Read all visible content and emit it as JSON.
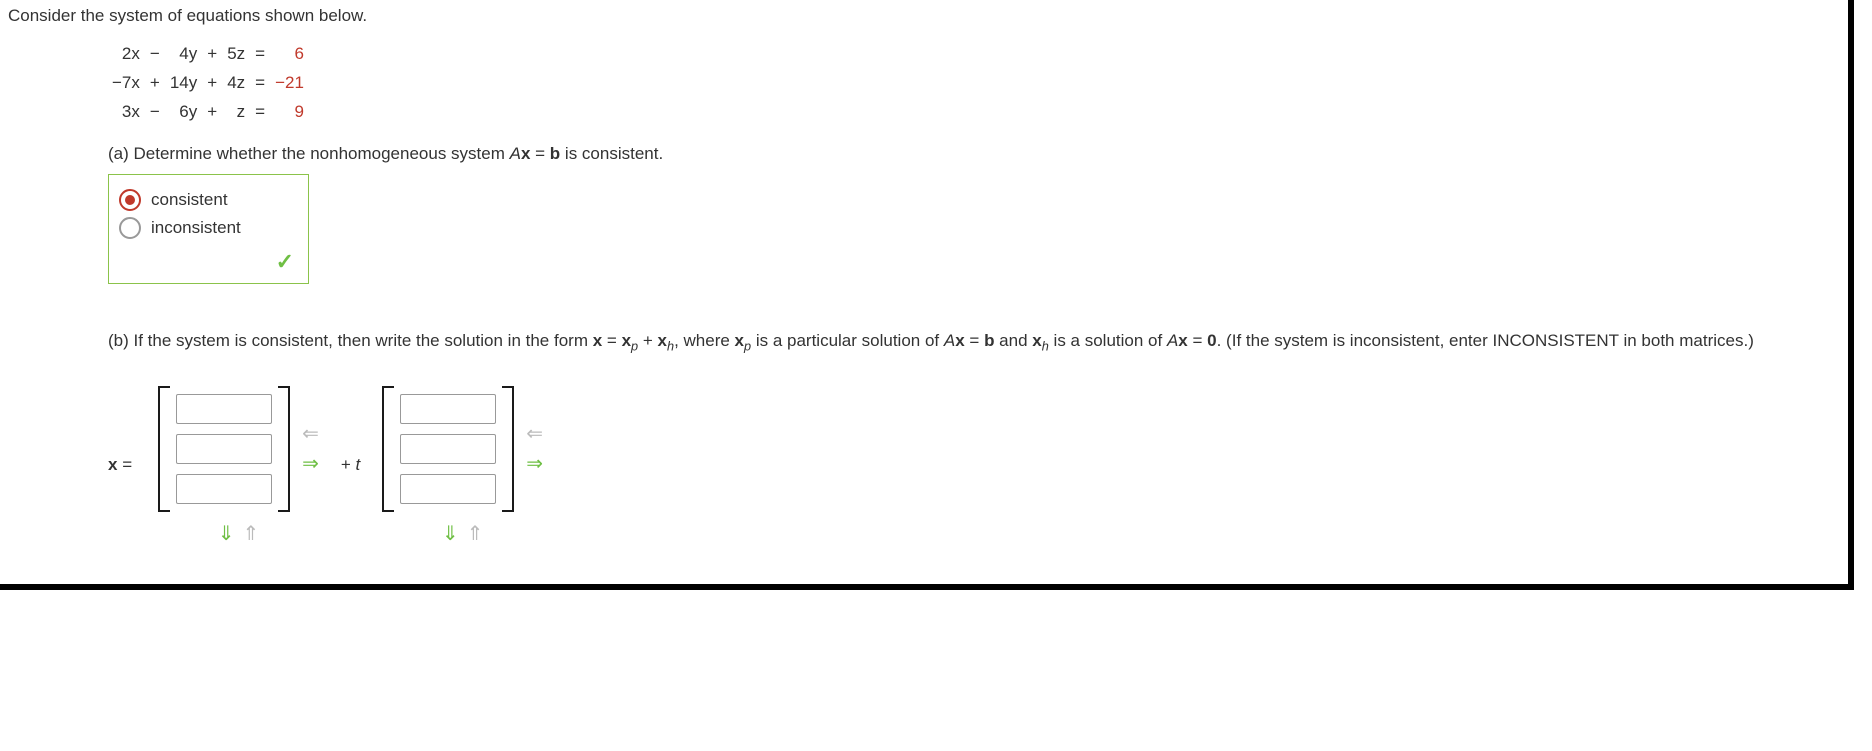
{
  "intro": "Consider the system of equations shown below.",
  "eq": {
    "r1": {
      "x": "2x",
      "s1": "−",
      "y": "4y",
      "s2": "+",
      "z": "5z",
      "eq": "=",
      "rhs": "6"
    },
    "r2": {
      "x": "−7x",
      "s1": "+",
      "y": "14y",
      "s2": "+",
      "z": "4z",
      "eq": "=",
      "rhs": "−21"
    },
    "r3": {
      "x": "3x",
      "s1": "−",
      "y": "6y",
      "s2": "+",
      "z": "z",
      "eq": "=",
      "rhs": "9"
    }
  },
  "partA": {
    "prefix": "(a) Determine whether the nonhomogeneous system ",
    "eqtext_A": "A",
    "eqtext_x": "x",
    "eqtext_eq": " = ",
    "eqtext_b": "b",
    "suffix": " is consistent.",
    "opt1": "consistent",
    "opt2": "inconsistent",
    "selected": "opt1"
  },
  "partB": {
    "t1": "(b) If the system is consistent, then write the solution in the form ",
    "t_x": "x",
    "t2": " = ",
    "t_xp_x": "x",
    "t_xp_p": "p",
    "t3": " + ",
    "t_xh_x": "x",
    "t_xh_h": "h",
    "t4": ", where ",
    "t_xp2_x": "x",
    "t_xp2_p": "p",
    "t5": " is a particular solution of ",
    "t_A": "A",
    "t_xx": "x",
    "t_eq": " = ",
    "t_b": "b",
    "t6": " and ",
    "t_xh2_x": "x",
    "t_xh2_h": "h",
    "t7": " is a solution of ",
    "t_A2": "A",
    "t_xx2": "x",
    "t_eq2": " = ",
    "t_zero": "0",
    "t8": ". (If the system is inconsistent, enter INCONSISTENT in both matrices.)",
    "label_x": "x",
    "label_eq": " =",
    "plus_t": "+ t",
    "xp": [
      "",
      "",
      ""
    ],
    "xh": [
      "",
      "",
      ""
    ]
  }
}
